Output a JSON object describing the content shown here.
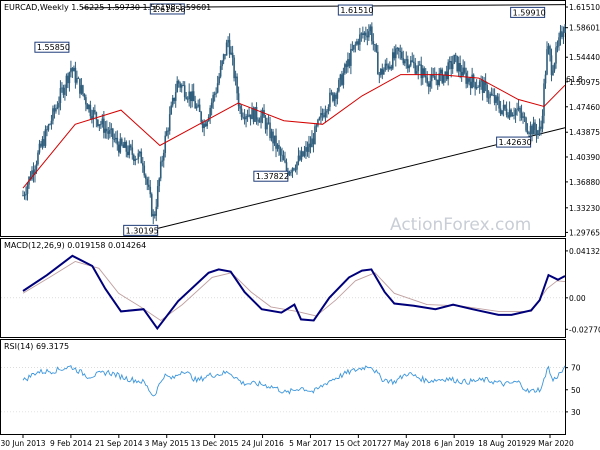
{
  "price_header": {
    "symbol": "EURCAD",
    "timeframe": "Weekly",
    "open": "1.56225",
    "high": "1.59730",
    "low": "1.56198",
    "close": "1.59601"
  },
  "macd_header": "MACD(12,26,9) 0.019158 0.014264",
  "rsi_header": "RSI(14) 69.3175",
  "watermark": "ActionForex.com",
  "colors": {
    "candle": "#2f5d7c",
    "ema": "#d40000",
    "macd": "#00007a",
    "signal": "#c0a0a0",
    "rsi": "#3c96dc",
    "lines": "#000000",
    "current_box": "#000000"
  },
  "chart_data": [
    {
      "type": "candlestick",
      "ylim": [
        1.2926,
        1.6236
      ],
      "y_ticks": [
        "1.61510",
        "1.58601",
        "1.54440",
        "1.50975",
        "1.47460",
        "1.43875",
        "1.40390",
        "1.36880",
        "1.33230",
        "1.29765"
      ],
      "current_price": "1.59601",
      "fib_label": "61.8",
      "annotations": [
        {
          "label": "1.55850",
          "date": "2014-02-09",
          "price": 1.5585
        },
        {
          "label": "1.30195",
          "date": "2015-03-03",
          "price": 1.30195
        },
        {
          "label": "1.61658",
          "date": "2015-07-15",
          "price": 1.61658
        },
        {
          "label": "1.37822",
          "date": "2016-11-10",
          "price": 1.37822
        },
        {
          "label": "1.61510",
          "date": "2017-12-10",
          "price": 1.6151
        },
        {
          "label": "1.42630",
          "date": "2019-12-20",
          "price": 1.4263
        },
        {
          "label": "1.59910",
          "date": "2020-03-18",
          "price": 1.5991
        }
      ],
      "key_points": [
        [
          "2013-06-30",
          1.35
        ],
        [
          "2013-10-20",
          1.44
        ],
        [
          "2014-02-09",
          1.53
        ],
        [
          "2014-05-11",
          1.47
        ],
        [
          "2014-09-21",
          1.42
        ],
        [
          "2015-01-11",
          1.4
        ],
        [
          "2015-03-03",
          1.315
        ],
        [
          "2015-04-20",
          1.42
        ],
        [
          "2015-06-22",
          1.51
        ],
        [
          "2015-08-23",
          1.49
        ],
        [
          "2015-10-25",
          1.45
        ],
        [
          "2015-12-20",
          1.5
        ],
        [
          "2016-02-15",
          1.57
        ],
        [
          "2016-04-10",
          1.47
        ],
        [
          "2016-07-24",
          1.46
        ],
        [
          "2016-10-10",
          1.41
        ],
        [
          "2016-11-13",
          1.385
        ],
        [
          "2017-01-15",
          1.4
        ],
        [
          "2017-03-05",
          1.42
        ],
        [
          "2017-05-21",
          1.48
        ],
        [
          "2017-07-10",
          1.5
        ],
        [
          "2017-09-15",
          1.55
        ],
        [
          "2017-10-15",
          1.57
        ],
        [
          "2017-12-10",
          1.585
        ],
        [
          "2018-01-21",
          1.52
        ],
        [
          "2018-04-20",
          1.55
        ],
        [
          "2018-07-15",
          1.53
        ],
        [
          "2018-09-20",
          1.51
        ],
        [
          "2018-11-25",
          1.52
        ],
        [
          "2019-01-06",
          1.54
        ],
        [
          "2019-03-01",
          1.515
        ],
        [
          "2019-05-13",
          1.505
        ],
        [
          "2019-08-18",
          1.47
        ],
        [
          "2019-10-25",
          1.47
        ],
        [
          "2019-12-20",
          1.445
        ],
        [
          "2020-02-15",
          1.44
        ],
        [
          "2020-03-02",
          1.505
        ],
        [
          "2020-03-18",
          1.56
        ],
        [
          "2020-04-05",
          1.53
        ],
        [
          "2020-04-29",
          1.55
        ],
        [
          "2020-05-20",
          1.575
        ],
        [
          "2020-06-07",
          1.596
        ]
      ],
      "ema_points": [
        [
          "2013-06-30",
          1.36
        ],
        [
          "2014-03-01",
          1.45
        ],
        [
          "2014-10-01",
          1.47
        ],
        [
          "2015-04-01",
          1.42
        ],
        [
          "2015-10-01",
          1.45
        ],
        [
          "2016-04-01",
          1.48
        ],
        [
          "2016-11-01",
          1.455
        ],
        [
          "2017-05-01",
          1.45
        ],
        [
          "2017-11-01",
          1.49
        ],
        [
          "2018-05-01",
          1.52
        ],
        [
          "2018-11-01",
          1.52
        ],
        [
          "2019-05-01",
          1.515
        ],
        [
          "2019-11-01",
          1.485
        ],
        [
          "2020-03-01",
          1.475
        ],
        [
          "2020-06-07",
          1.505
        ]
      ],
      "trendline": [
        [
          "2015-03-03",
          1.30195
        ],
        [
          "2020-06-07",
          1.445
        ]
      ],
      "resistance_line": [
        [
          "2014-04-01",
          1.614
        ],
        [
          "2020-06-07",
          1.6185
        ]
      ]
    },
    {
      "type": "line",
      "title": "MACD(12,26,9)",
      "ylim": [
        -0.0345,
        0.0518
      ],
      "y_ticks": [
        "0.041325",
        "0.00",
        "-0.027702"
      ],
      "macd_points": [
        [
          "2013-06-30",
          0.006
        ],
        [
          "2013-10-20",
          0.02
        ],
        [
          "2014-02-16",
          0.037
        ],
        [
          "2014-05-20",
          0.028
        ],
        [
          "2014-07-20",
          0.008
        ],
        [
          "2014-10-01",
          -0.012
        ],
        [
          "2015-01-15",
          -0.01
        ],
        [
          "2015-03-20",
          -0.027
        ],
        [
          "2015-06-25",
          -0.003
        ],
        [
          "2015-11-15",
          0.022
        ],
        [
          "2016-01-01",
          0.025
        ],
        [
          "2016-02-26",
          0.023
        ],
        [
          "2016-05-01",
          0.005
        ],
        [
          "2016-07-20",
          -0.01
        ],
        [
          "2016-10-20",
          -0.013
        ],
        [
          "2016-12-20",
          -0.006
        ],
        [
          "2017-01-20",
          -0.019
        ],
        [
          "2017-03-20",
          -0.02
        ],
        [
          "2017-06-01",
          0.0
        ],
        [
          "2017-09-01",
          0.018
        ],
        [
          "2017-11-01",
          0.024
        ],
        [
          "2017-12-15",
          0.025
        ],
        [
          "2018-02-15",
          0.005
        ],
        [
          "2018-04-01",
          -0.005
        ],
        [
          "2018-07-01",
          -0.007
        ],
        [
          "2018-10-10",
          -0.01
        ],
        [
          "2019-01-01",
          -0.006
        ],
        [
          "2019-04-01",
          -0.01
        ],
        [
          "2019-08-01",
          -0.015
        ],
        [
          "2019-10-01",
          -0.015
        ],
        [
          "2020-01-01",
          -0.011
        ],
        [
          "2020-02-10",
          -0.002
        ],
        [
          "2020-03-22",
          0.02
        ],
        [
          "2020-05-05",
          0.016
        ],
        [
          "2020-06-07",
          0.0192
        ]
      ],
      "signal_points": [
        [
          "2013-06-30",
          0.004
        ],
        [
          "2013-11-01",
          0.018
        ],
        [
          "2014-03-01",
          0.032
        ],
        [
          "2014-06-20",
          0.026
        ],
        [
          "2014-09-20",
          0.004
        ],
        [
          "2015-01-01",
          -0.008
        ],
        [
          "2015-04-05",
          -0.02
        ],
        [
          "2015-07-15",
          -0.006
        ],
        [
          "2015-12-01",
          0.018
        ],
        [
          "2016-03-01",
          0.022
        ],
        [
          "2016-06-01",
          0.005
        ],
        [
          "2016-09-01",
          -0.008
        ],
        [
          "2017-01-01",
          -0.012
        ],
        [
          "2017-04-01",
          -0.016
        ],
        [
          "2017-07-01",
          -0.002
        ],
        [
          "2017-10-01",
          0.015
        ],
        [
          "2018-01-01",
          0.022
        ],
        [
          "2018-04-01",
          0.004
        ],
        [
          "2018-09-01",
          -0.006
        ],
        [
          "2019-02-01",
          -0.007
        ],
        [
          "2019-08-01",
          -0.012
        ],
        [
          "2020-01-01",
          -0.012
        ],
        [
          "2020-03-15",
          0.008
        ],
        [
          "2020-05-01",
          0.015
        ],
        [
          "2020-06-07",
          0.0143
        ]
      ]
    },
    {
      "type": "line",
      "title": "RSI(14)",
      "ylim": [
        10,
        95
      ],
      "y_ticks": [
        "70",
        "50",
        "30"
      ],
      "rsi_points": [
        [
          "2013-06-30",
          58
        ],
        [
          "2013-09-01",
          66
        ],
        [
          "2013-11-20",
          67
        ],
        [
          "2014-02-09",
          71
        ],
        [
          "2014-05-01",
          62
        ],
        [
          "2014-08-01",
          66
        ],
        [
          "2014-11-01",
          60
        ],
        [
          "2015-01-15",
          57
        ],
        [
          "2015-03-03",
          44
        ],
        [
          "2015-04-20",
          63
        ],
        [
          "2015-06-01",
          60
        ],
        [
          "2015-07-20",
          68
        ],
        [
          "2015-09-20",
          58
        ],
        [
          "2015-11-15",
          63
        ],
        [
          "2016-01-01",
          64
        ],
        [
          "2016-02-20",
          66
        ],
        [
          "2016-04-20",
          56
        ],
        [
          "2016-07-20",
          55
        ],
        [
          "2016-09-20",
          52
        ],
        [
          "2016-11-13",
          47
        ],
        [
          "2017-01-20",
          52
        ],
        [
          "2017-03-20",
          48
        ],
        [
          "2017-06-01",
          58
        ],
        [
          "2017-09-01",
          66
        ],
        [
          "2017-12-10",
          72
        ],
        [
          "2018-02-01",
          60
        ],
        [
          "2018-04-01",
          57
        ],
        [
          "2018-06-01",
          65
        ],
        [
          "2018-09-01",
          58
        ],
        [
          "2018-12-01",
          60
        ],
        [
          "2019-03-01",
          57
        ],
        [
          "2019-06-01",
          59
        ],
        [
          "2019-09-01",
          55
        ],
        [
          "2019-11-01",
          57
        ],
        [
          "2019-12-20",
          48
        ],
        [
          "2020-02-20",
          51
        ],
        [
          "2020-03-18",
          72
        ],
        [
          "2020-04-10",
          58
        ],
        [
          "2020-05-10",
          64
        ],
        [
          "2020-06-07",
          69.3
        ]
      ]
    }
  ],
  "x_axis": [
    {
      "label": "30 Jun 2013",
      "date": "2013-06-30"
    },
    {
      "label": "9 Feb 2014",
      "date": "2014-02-09"
    },
    {
      "label": "21 Sep 2014",
      "date": "2014-09-21"
    },
    {
      "label": "3 May 2015",
      "date": "2015-05-03"
    },
    {
      "label": "13 Dec 2015",
      "date": "2015-12-13"
    },
    {
      "label": "24 Jul 2016",
      "date": "2016-07-24"
    },
    {
      "label": "5 Mar 2017",
      "date": "2017-03-05"
    },
    {
      "label": "15 Oct 2017",
      "date": "2017-10-15"
    },
    {
      "label": "27 May 2018",
      "date": "2018-05-27"
    },
    {
      "label": "6 Jan 2019",
      "date": "2019-01-06"
    },
    {
      "label": "18 Aug 2019",
      "date": "2019-08-18"
    },
    {
      "label": "29 Mar 2020",
      "date": "2020-03-29"
    }
  ]
}
